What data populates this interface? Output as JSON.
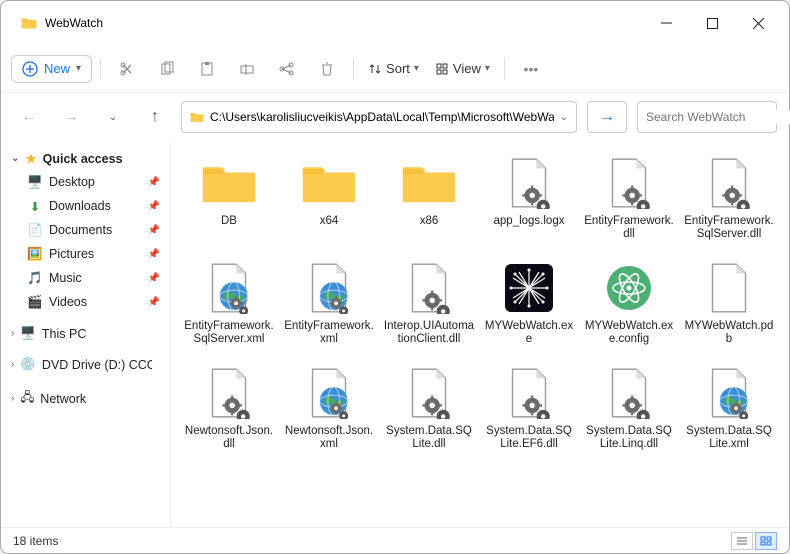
{
  "window": {
    "title": "WebWatch"
  },
  "toolbar": {
    "new_label": "New",
    "sort_label": "Sort",
    "view_label": "View"
  },
  "addressbar": {
    "path": "C:\\Users\\karolisliucveikis\\AppData\\Local\\Temp\\Microsoft\\WebWatch",
    "search_placeholder": "Search WebWatch"
  },
  "sidebar": {
    "quick_access": "Quick access",
    "items": [
      {
        "label": "Desktop",
        "pinned": true,
        "color": "#2877c8",
        "type": "desktop"
      },
      {
        "label": "Downloads",
        "pinned": true,
        "color": "#2f9c47",
        "type": "downloads"
      },
      {
        "label": "Documents",
        "pinned": true,
        "color": "#3b6fd1",
        "type": "documents"
      },
      {
        "label": "Pictures",
        "pinned": true,
        "color": "#2fa7c8",
        "type": "pictures"
      },
      {
        "label": "Music",
        "pinned": true,
        "color": "#c24d9c",
        "type": "music"
      },
      {
        "label": "Videos",
        "pinned": true,
        "color": "#7a4dc2",
        "type": "videos"
      }
    ],
    "this_pc": "This PC",
    "dvd": "DVD Drive (D:) CCCC",
    "network": "Network"
  },
  "files": [
    {
      "name": "DB",
      "type": "folder"
    },
    {
      "name": "x64",
      "type": "folder"
    },
    {
      "name": "x86",
      "type": "folder"
    },
    {
      "name": "app_logs.logx",
      "type": "gearfile"
    },
    {
      "name": "EntityFramework.dll",
      "type": "gearfile"
    },
    {
      "name": "EntityFramework.SqlServer.dll",
      "type": "gearfile"
    },
    {
      "name": "EntityFramework.SqlServer.xml",
      "type": "xmlfile"
    },
    {
      "name": "EntityFramework.xml",
      "type": "xmlfile"
    },
    {
      "name": "Interop.UIAutomationClient.dll",
      "type": "gearfile"
    },
    {
      "name": "MYWebWatch.exe",
      "type": "webwatch"
    },
    {
      "name": "MYWebWatch.exe.config",
      "type": "atom"
    },
    {
      "name": "MYWebWatch.pdb",
      "type": "blankfile"
    },
    {
      "name": "Newtonsoft.Json.dll",
      "type": "gearfile"
    },
    {
      "name": "Newtonsoft.Json.xml",
      "type": "xmlfile"
    },
    {
      "name": "System.Data.SQLite.dll",
      "type": "gearfile"
    },
    {
      "name": "System.Data.SQLite.EF6.dll",
      "type": "gearfile"
    },
    {
      "name": "System.Data.SQLite.Linq.dll",
      "type": "gearfile"
    },
    {
      "name": "System.Data.SQLite.xml",
      "type": "xmlfile"
    }
  ],
  "statusbar": {
    "count_label": "18 items"
  }
}
